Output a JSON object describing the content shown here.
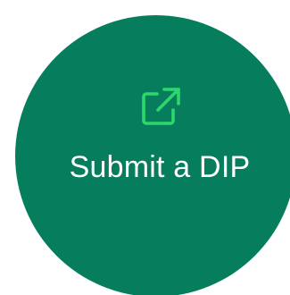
{
  "button": {
    "label": "Submit a DIP",
    "icon": "external-link-icon",
    "background_color": "#067D5C",
    "icon_color": "#2BD96B",
    "text_color": "#FFFFFF"
  }
}
